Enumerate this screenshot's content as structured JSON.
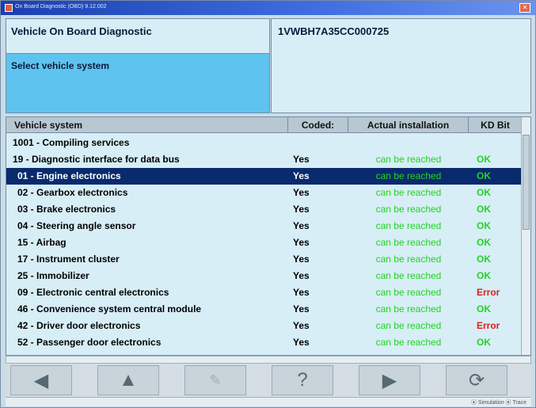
{
  "window": {
    "title": "On Board Diagnostic (OBD) 9.12.002"
  },
  "header": {
    "title": "Vehicle On Board Diagnostic",
    "subtitle": "Select vehicle system",
    "vin": "1VWBH7A35CC000725"
  },
  "table": {
    "columns": [
      "Vehicle system",
      "Coded:",
      "Actual installation",
      "KD Bit"
    ],
    "rows": [
      {
        "system": "1001 - Compiling services",
        "coded": "",
        "actual": "",
        "kd": "",
        "kd_status": ""
      },
      {
        "system": "19 - Diagnostic interface for data bus",
        "coded": "Yes",
        "actual": "can be reached",
        "kd": "OK",
        "kd_status": "ok"
      },
      {
        "system": "01 - Engine electronics",
        "coded": "Yes",
        "actual": "can be reached",
        "kd": "OK",
        "kd_status": "ok",
        "selected": true
      },
      {
        "system": "02 - Gearbox electronics",
        "coded": "Yes",
        "actual": "can be reached",
        "kd": "OK",
        "kd_status": "ok"
      },
      {
        "system": "03 - Brake electronics",
        "coded": "Yes",
        "actual": "can be reached",
        "kd": "OK",
        "kd_status": "ok"
      },
      {
        "system": "04 - Steering angle sensor",
        "coded": "Yes",
        "actual": "can be reached",
        "kd": "OK",
        "kd_status": "ok"
      },
      {
        "system": "15 - Airbag",
        "coded": "Yes",
        "actual": "can be reached",
        "kd": "OK",
        "kd_status": "ok"
      },
      {
        "system": "17 - Instrument cluster",
        "coded": "Yes",
        "actual": "can be reached",
        "kd": "OK",
        "kd_status": "ok"
      },
      {
        "system": "25 - Immobilizer",
        "coded": "Yes",
        "actual": "can be reached",
        "kd": "OK",
        "kd_status": "ok"
      },
      {
        "system": "09 - Electronic central electronics",
        "coded": "Yes",
        "actual": "can be reached",
        "kd": "Error",
        "kd_status": "error"
      },
      {
        "system": "46 - Convenience system central module",
        "coded": "Yes",
        "actual": "can be reached",
        "kd": "OK",
        "kd_status": "ok"
      },
      {
        "system": "42 - Driver door electronics",
        "coded": "Yes",
        "actual": "can be reached",
        "kd": "Error",
        "kd_status": "error"
      },
      {
        "system": "52 - Passenger door electronics",
        "coded": "Yes",
        "actual": "can be reached",
        "kd": "OK",
        "kd_status": "ok"
      }
    ]
  },
  "toolbar": {
    "buttons": [
      {
        "name": "back-button",
        "icon": "arrow-left-icon",
        "glyph": "◀"
      },
      {
        "name": "up-button",
        "icon": "arrow-up-icon",
        "glyph": "▲"
      },
      {
        "name": "tools-button",
        "icon": "wrench-icon",
        "glyph": "✎"
      },
      {
        "name": "help-button",
        "icon": "question-icon",
        "glyph": "?"
      },
      {
        "name": "forward-button",
        "icon": "arrow-right-icon",
        "glyph": "▶"
      },
      {
        "name": "refresh-button",
        "icon": "refresh-icon",
        "glyph": "⟳"
      }
    ]
  },
  "status": {
    "text": "⦿ Simulation  ⦿ Trace"
  },
  "colors": {
    "selected_row": "#0a2a6e",
    "ok": "#22d422",
    "error": "#e11d1d",
    "panel_highlight": "#5ec3ef"
  }
}
